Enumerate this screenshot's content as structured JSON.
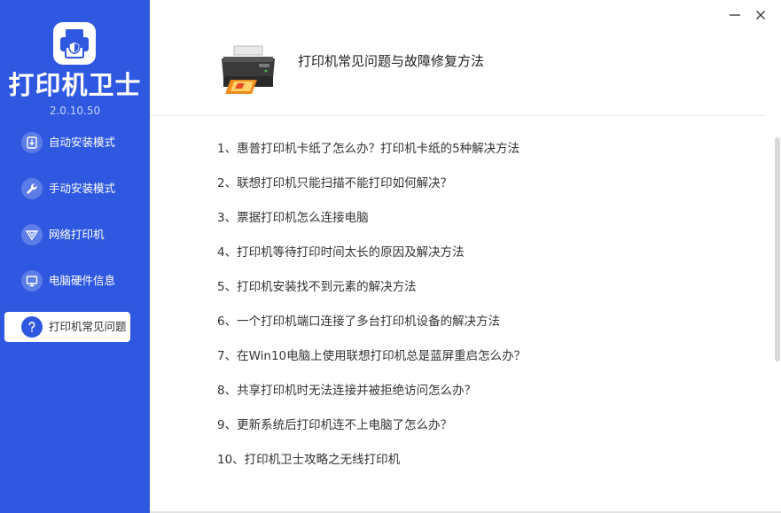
{
  "app": {
    "name": "打印机卫士",
    "version": "2.0.10.50"
  },
  "colors": {
    "sidebar": "#2f58e0",
    "active_item_bg": "#ffffff",
    "text": "#333333"
  },
  "sidebar": {
    "items": [
      {
        "label": "自动安装模式",
        "icon": "auto-install-icon",
        "active": false
      },
      {
        "label": "手动安装模式",
        "icon": "wrench-icon",
        "active": false
      },
      {
        "label": "网络打印机",
        "icon": "network-icon",
        "active": false
      },
      {
        "label": "电脑硬件信息",
        "icon": "monitor-icon",
        "active": false
      },
      {
        "label": "打印机常见问题",
        "icon": "question-icon",
        "active": true
      }
    ]
  },
  "header": {
    "title": "打印机常见问题与故障修复方法"
  },
  "faq": {
    "items": [
      "1、惠普打印机卡纸了怎么办？打印机卡纸的5种解决方法",
      "2、联想打印机只能扫描不能打印如何解决？",
      "3、票据打印机怎么连接电脑",
      "4、打印机等待打印时间太长的原因及解决方法",
      "5、打印机安装找不到元素的解决方法",
      "6、一个打印机端口连接了多台打印机设备的解决方法",
      "7、在Win10电脑上使用联想打印机总是蓝屏重启怎么办？",
      "8、共享打印机时无法连接并被拒绝访问怎么办？",
      "9、更新系统后打印机连不上电脑了怎么办？",
      "10、打印机卫士攻略之无线打印机"
    ]
  }
}
